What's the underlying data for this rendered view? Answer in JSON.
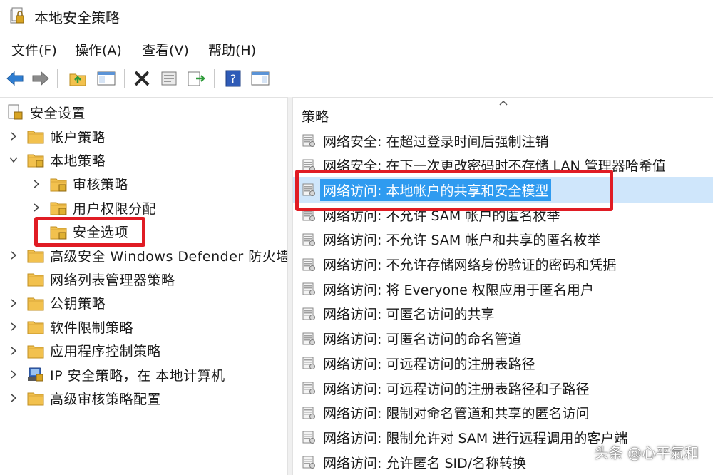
{
  "window": {
    "title": "本地安全策略"
  },
  "menu": [
    "文件(F)",
    "操作(A)",
    "查看(V)",
    "帮助(H)"
  ],
  "toolbar": [
    "back-arrow-icon",
    "forward-arrow-icon",
    "up-folder-icon",
    "show-tree-icon",
    "delete-icon",
    "properties-icon",
    "export-list-icon",
    "help-icon",
    "console-view-icon"
  ],
  "tree": {
    "root": "安全设置",
    "items": [
      {
        "label": "帐户策略",
        "expander": "collapsed"
      },
      {
        "label": "本地策略",
        "expander": "expanded"
      },
      {
        "label": "审核策略",
        "expander": "collapsed"
      },
      {
        "label": "用户权限分配",
        "expander": "collapsed"
      },
      {
        "label": "安全选项",
        "expander": "none",
        "selected": true
      },
      {
        "label": "高级安全 Windows Defender 防火墙",
        "expander": "collapsed"
      },
      {
        "label": "网络列表管理器策略",
        "expander": "none"
      },
      {
        "label": "公钥策略",
        "expander": "collapsed"
      },
      {
        "label": "软件限制策略",
        "expander": "collapsed"
      },
      {
        "label": "应用程序控制策略",
        "expander": "collapsed"
      },
      {
        "label": "IP 安全策略，在 本地计算机",
        "expander": "collapsed"
      },
      {
        "label": "高级审核策略配置",
        "expander": "collapsed"
      }
    ]
  },
  "list": {
    "header": "策略",
    "items": [
      "网络安全: 在超过登录时间后强制注销",
      "网络安全: 在下一次更改密码时不存储 LAN 管理器哈希值",
      "网络访问: 本地帐户的共享和安全模型",
      "网络访问: 不允许 SAM 帐户的匿名枚举",
      "网络访问: 不允许 SAM 帐户和共享的匿名枚举",
      "网络访问: 不允许存储网络身份验证的密码和凭据",
      "网络访问: 将 Everyone 权限应用于匿名用户",
      "网络访问: 可匿名访问的共享",
      "网络访问: 可匿名访问的命名管道",
      "网络访问: 可远程访问的注册表路径",
      "网络访问: 可远程访问的注册表路径和子路径",
      "网络访问: 限制对命名管道和共享的匿名访问",
      "网络访问: 限制允许对 SAM 进行远程调用的客户端",
      "网络访问: 允许匿名 SID/名称转换"
    ],
    "selected_index": 2
  },
  "watermark": "头条 @心平氣和",
  "colors": {
    "selection": "#2f9bf0",
    "highlight_box": "#e01c24",
    "folder": "#f2c14e"
  }
}
